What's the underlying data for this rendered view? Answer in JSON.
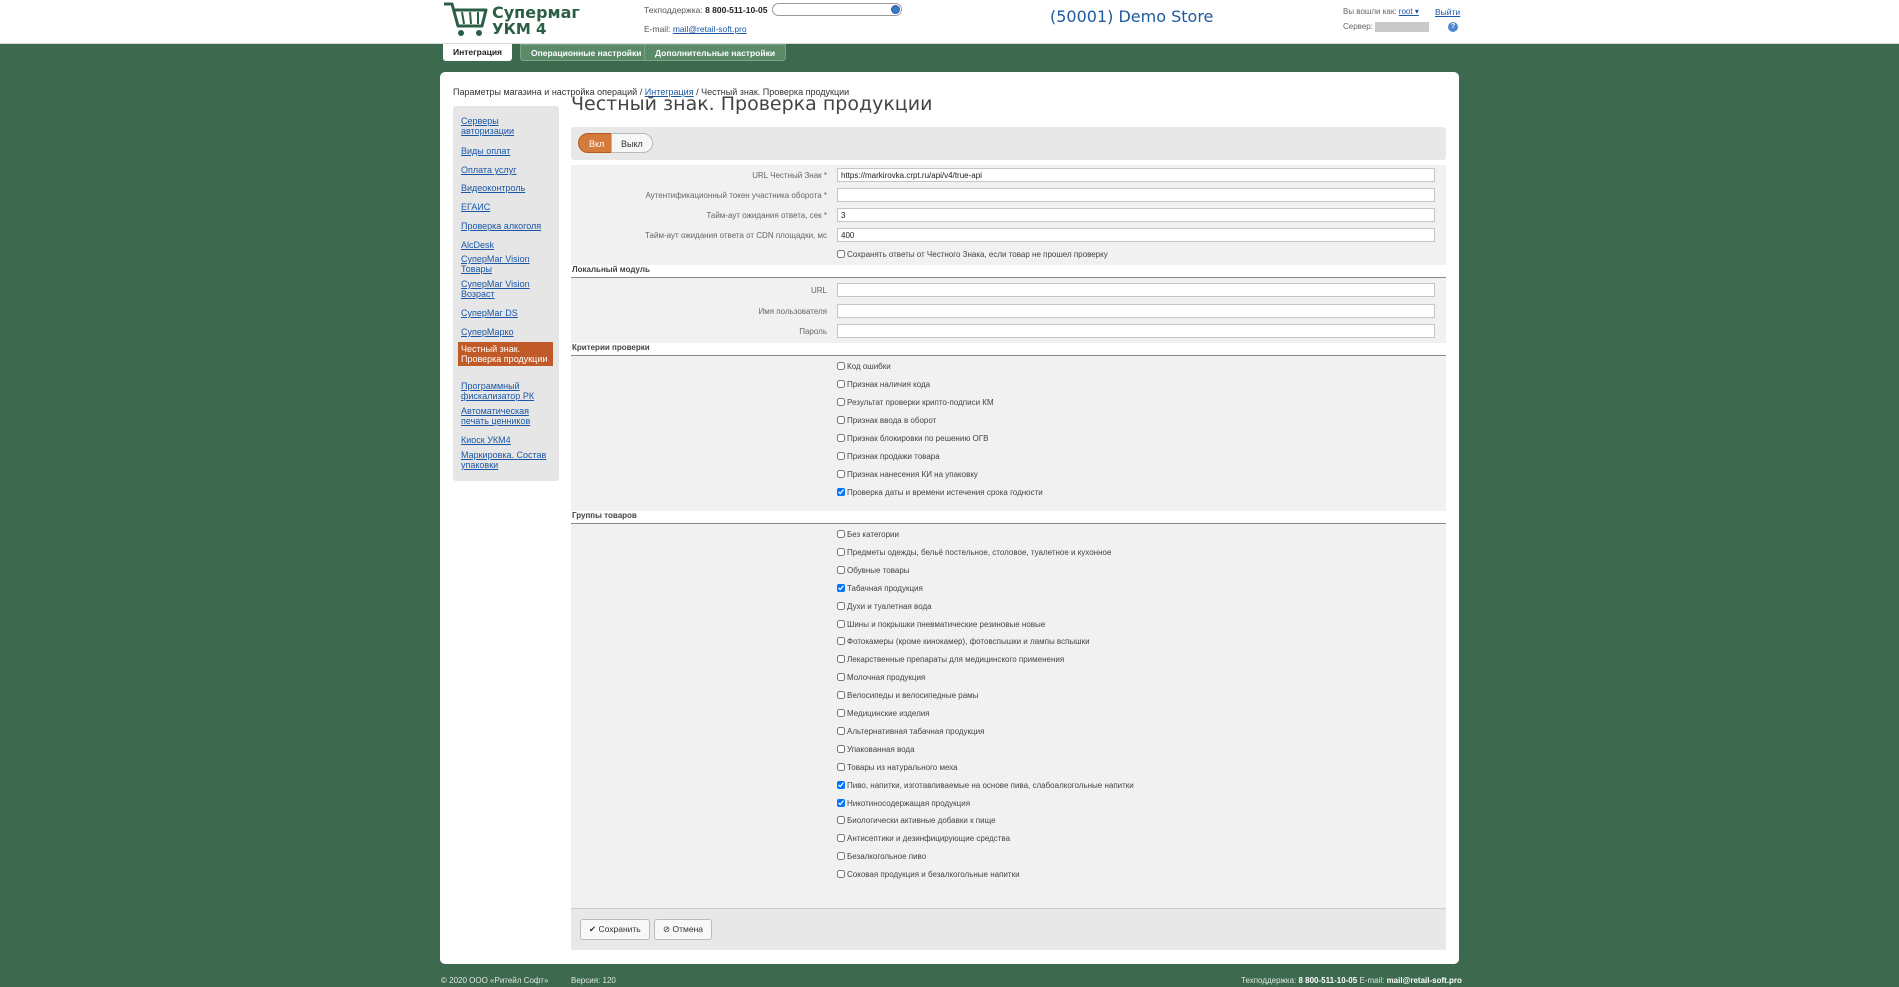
{
  "header": {
    "logo_line1": "Супермаг",
    "logo_line2": "УКМ 4",
    "support_label": "Техподдержка:",
    "support_phone": "8 800-511-10-05",
    "email_label": "E-mail:",
    "email": "mail@retail-soft.pro",
    "store_title": "(50001) Demo Store",
    "logged_as_label": "Вы вошли как:",
    "user": "root",
    "logout": "Выйти",
    "server_label": "Сервер:",
    "help": "?"
  },
  "top_tabs": [
    {
      "label": "Интеграция"
    },
    {
      "label": "Операционные настройки"
    },
    {
      "label": "Дополнительные настройки"
    }
  ],
  "breadcrumb": {
    "part1": "Параметры магазина и настройка операций",
    "sep": "/",
    "part2": "Интеграция",
    "part3": "Честный знак. Проверка продукции"
  },
  "sidebar": {
    "items": [
      {
        "label": "Серверы авторизации"
      },
      {
        "label": "Виды оплат"
      },
      {
        "label": "Оплата услуг"
      },
      {
        "label": "Видеоконтроль"
      },
      {
        "label": "ЕГАИС"
      },
      {
        "label": "Проверка алкоголя"
      },
      {
        "label": "AlcDesk"
      },
      {
        "label": "СуперМаг Vision Товары"
      },
      {
        "label": "СуперМаг Vision Возраст"
      },
      {
        "label": "СуперМаг DS"
      },
      {
        "label": "СуперМарко"
      },
      {
        "label": "Честный знак. Проверка продукции"
      },
      {
        "label": "Программный фискализатор РК"
      },
      {
        "label": "Автоматическая печать ценников"
      },
      {
        "label": "Киоск УКМ4"
      },
      {
        "label": "Маркировка. Состав упаковки"
      }
    ]
  },
  "main": {
    "title": "Честный знак. Проверка продукции",
    "toggle_on": "Вкл",
    "toggle_off": "Выкл",
    "fields": [
      {
        "label": "URL Честный Знак *",
        "value": "https://markirovka.crpt.ru/api/v4/true-api"
      },
      {
        "label": "Аутентификационный токен участника оборота *",
        "value": ""
      },
      {
        "label": "Тайм-аут ожидания ответа, сек *",
        "value": "3"
      },
      {
        "label": "Тайм-аут ожидания ответа от CDN площадки, мс",
        "value": "400"
      }
    ],
    "save_answers": {
      "label": "Сохранять ответы от Честного Знака, если товар не прошел проверку",
      "checked": false
    },
    "local_module": {
      "heading": "Локальный модуль",
      "fields": [
        {
          "label": "URL",
          "value": ""
        },
        {
          "label": "Имя пользователя",
          "value": ""
        },
        {
          "label": "Пароль",
          "value": ""
        }
      ]
    },
    "criteria": {
      "heading": "Критерии проверки",
      "items": [
        {
          "label": "Код ошибки",
          "checked": false
        },
        {
          "label": "Признак наличия кода",
          "checked": false
        },
        {
          "label": "Результат проверки крипто-подписи КМ",
          "checked": false
        },
        {
          "label": "Признак ввода в оборот",
          "checked": false
        },
        {
          "label": "Признак блокировки по решению ОГВ",
          "checked": false
        },
        {
          "label": "Признак продажи товара",
          "checked": false
        },
        {
          "label": "Признак нанесения КИ на упаковку",
          "checked": false
        },
        {
          "label": "Проверка даты и времени истечения срока годности",
          "checked": true
        }
      ]
    },
    "groups": {
      "heading": "Группы товаров",
      "items": [
        {
          "label": "Без категории",
          "checked": false
        },
        {
          "label": "Предметы одежды, бельё постельное, столовое, туалетное и кухонное",
          "checked": false
        },
        {
          "label": "Обувные товары",
          "checked": false
        },
        {
          "label": "Табачная продукция",
          "checked": true
        },
        {
          "label": "Духи и туалетная вода",
          "checked": false
        },
        {
          "label": "Шины и покрышки пневматические резиновые новые",
          "checked": false
        },
        {
          "label": "Фотокамеры (кроме кинокамер), фотовспышки и лампы вспышки",
          "checked": false
        },
        {
          "label": "Лекарственные препараты для медицинского применения",
          "checked": false
        },
        {
          "label": "Молочная продукция",
          "checked": false
        },
        {
          "label": "Велосипеды и велосипедные рамы",
          "checked": false
        },
        {
          "label": "Медицинские изделия",
          "checked": false
        },
        {
          "label": "Альтернативная табачная продукция",
          "checked": false
        },
        {
          "label": "Упакованная вода",
          "checked": false
        },
        {
          "label": "Товары из натурального меха",
          "checked": false
        },
        {
          "label": "Пиво, напитки, изготавливаемые на основе пива, слабоалкогольные напитки",
          "checked": true
        },
        {
          "label": "Никотиносодержащая продукция",
          "checked": true
        },
        {
          "label": "Биологически активные добавки к пище",
          "checked": false
        },
        {
          "label": "Антисептики и дезинфицирующие средства",
          "checked": false
        },
        {
          "label": "Безалкогольное пиво",
          "checked": false
        },
        {
          "label": "Соковая продукция и безалкогольные напитки",
          "checked": false
        }
      ]
    },
    "save_button": "Сохранить",
    "cancel_button": "Отмена"
  },
  "footer": {
    "copyright": "© 2020 ООО «Ритейл Софт»",
    "version_label": "Версия:",
    "version": "120",
    "support_label": "Техподдержка:",
    "support_phone": "8 800-511-10-05",
    "email_label": "E-mail:",
    "email": "mail@retail-soft.pro"
  },
  "colors": {
    "background": "#3d6a4f",
    "accent": "#c05a28",
    "link": "#1a57a7"
  }
}
